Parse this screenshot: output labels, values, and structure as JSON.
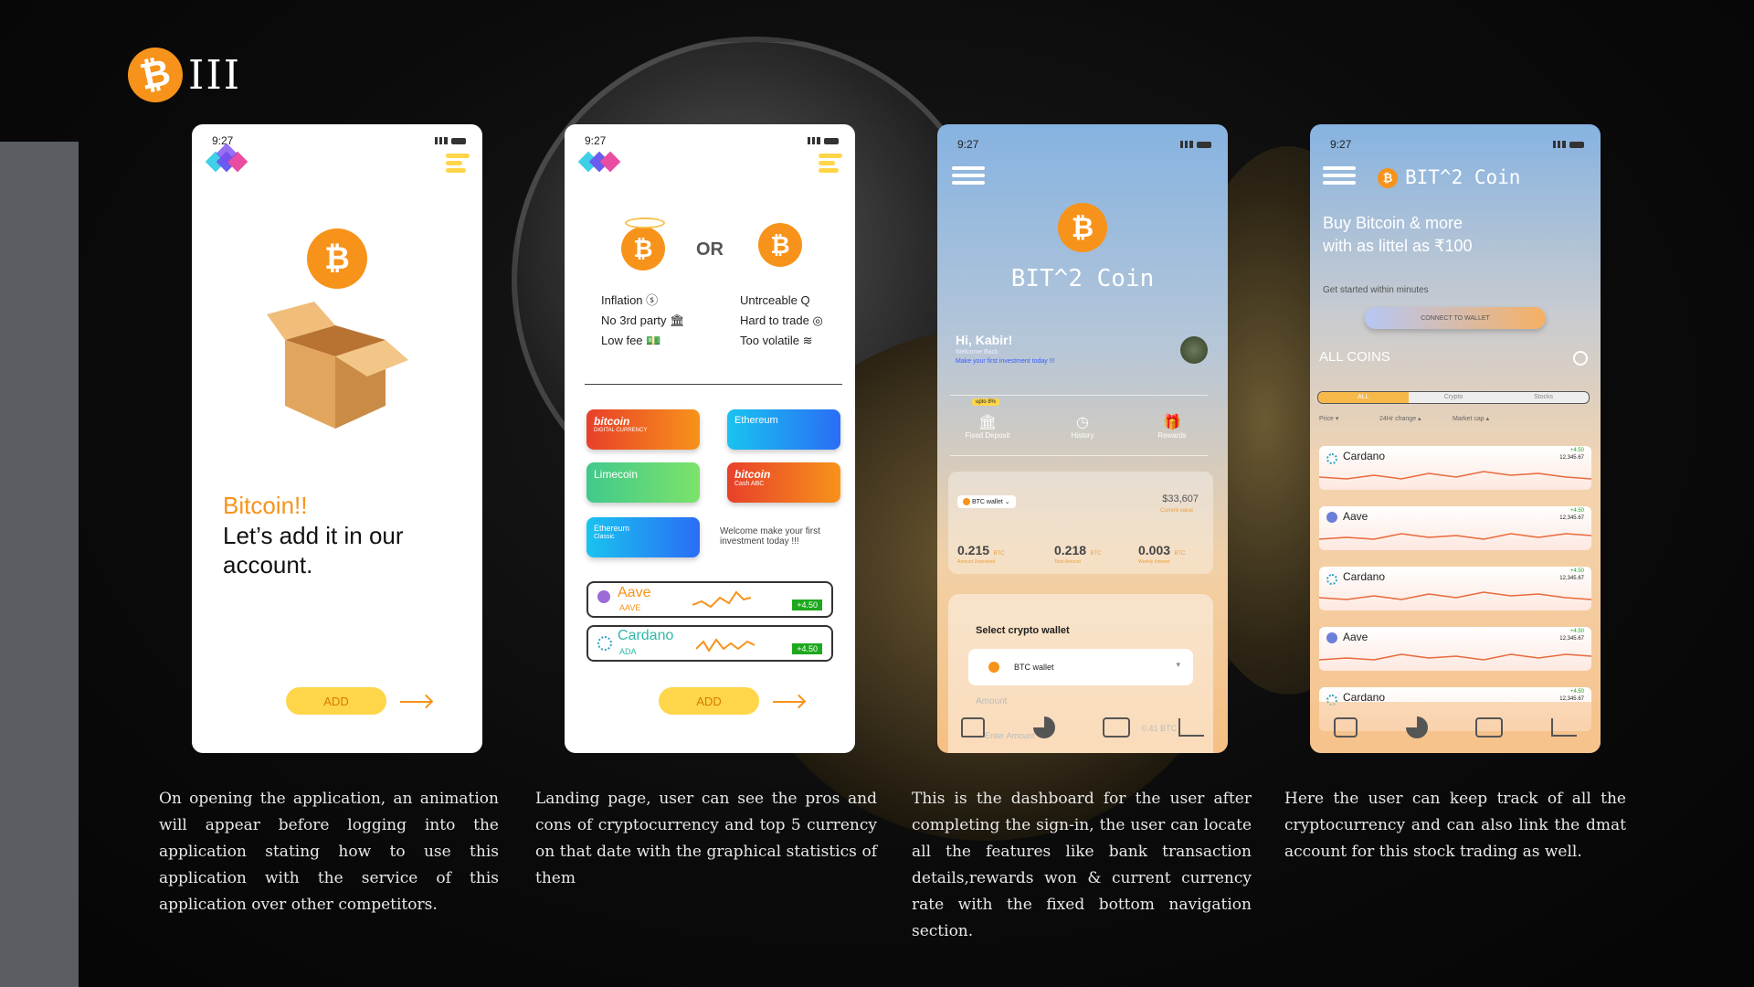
{
  "brand": {
    "coin_symbol": "₿",
    "text": "III"
  },
  "colors": {
    "accent": "#f7931a",
    "add_button": "#ffd54a",
    "dashboard_top": "#8fb8e0",
    "dashboard_bottom": "#f6c38a"
  },
  "status_time": "9:27",
  "screen1": {
    "title": "Bitcoin!!",
    "subtitle": "Let’s add it in our account.",
    "add_label": "ADD"
  },
  "screen2": {
    "or_label": "OR",
    "pros": [
      "Inflation ⓢ",
      "No 3rd party 🏛",
      "Low fee 💵"
    ],
    "cons": [
      "Untrceable Q",
      "Hard to trade ◎",
      "Too volatile ≋"
    ],
    "cards": [
      {
        "label": "bitcoin",
        "sub": "DIGITAL CURRENCY"
      },
      {
        "label": "Ethereum",
        "sub": ""
      },
      {
        "label": "Limecoin",
        "sub": ""
      },
      {
        "label": "bitcoin",
        "sub": "Cash ABC"
      },
      {
        "label": "Ethereum",
        "sub": "Classic"
      }
    ],
    "welcome": "Welcome make your first investment today !!!",
    "list": [
      {
        "name": "Aave",
        "ticker": "AAVE",
        "change": "+4.50"
      },
      {
        "name": "Cardano",
        "ticker": "ADA",
        "change": "+4.50"
      }
    ],
    "add_label": "ADD"
  },
  "screen3": {
    "app_title": "BIT^2 Coin",
    "greeting": "Hi, Kabir!",
    "welcome_back": "Welcome Back",
    "hint": "Make your first investment today !!!",
    "badge": "upto 8%",
    "tabs": [
      "Fixed Deposit",
      "History",
      "Rewards"
    ],
    "wallet_label": "BTC wallet",
    "wallet_total": "$33,607",
    "wallet_total_sub": "Current value",
    "stats": [
      {
        "value": "0.215",
        "unit": "BTC",
        "label": "Amount Deposited"
      },
      {
        "value": "0.218",
        "unit": "BTC",
        "label": "Total Amount"
      },
      {
        "value": "0.003",
        "unit": "BTC",
        "label": "Weekly Interest"
      }
    ],
    "select_title": "Select crypto wallet",
    "select_value": "BTC wallet",
    "amount_label": "Amount",
    "amount_placeholder": "Enter Amount",
    "amount_unit": "0.41 BTC"
  },
  "screen4": {
    "app_title": "BIT^2 Coin",
    "headline": "Buy Bitcoin & more with as littel as ₹100",
    "sub": "Get started within minutes",
    "connect": "CONNECT TO WALLET",
    "all_coins": "ALL COINS",
    "filters": [
      "ALL",
      "Crypto",
      "Stocks"
    ],
    "sorts": [
      "Price",
      "24Hr change",
      "Market cap"
    ],
    "coins": [
      {
        "name": "Cardano",
        "change": "+4.50",
        "price": "12,345.67"
      },
      {
        "name": "Aave",
        "change": "+4.50",
        "price": "12,345.67"
      },
      {
        "name": "Cardano",
        "change": "+4.50",
        "price": "12,345.67"
      },
      {
        "name": "Aave",
        "change": "+4.50",
        "price": "12,345.67"
      },
      {
        "name": "Cardano",
        "change": "+4.50",
        "price": "12,345.67"
      }
    ]
  },
  "captions": [
    "On opening the application, an animation will appear before logging into the application stating how to use this application with the service of this application over other competitors.",
    "Landing page, user can see the pros and cons of cryptocurrency and top 5 currency on that date with the graphical statistics of them",
    "This is the dashboard for the user after completing the sign-in, the user can locate all the features like bank transaction details,rewards won & current currency rate with the fixed bottom navigation section.",
    "Here the user can keep track of all the cryptocurrency and can also link the dmat account for this stock trading as well."
  ]
}
